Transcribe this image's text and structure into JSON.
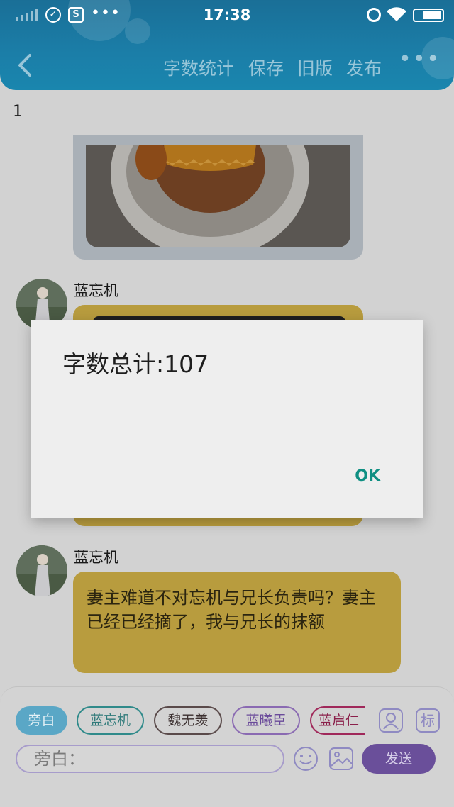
{
  "status_bar": {
    "time": "17:38",
    "sim_label": "S",
    "dots": "•••"
  },
  "nav": {
    "items": [
      "字数统计",
      "保存",
      "旧版",
      "发布"
    ],
    "more": "•••"
  },
  "page_number": "1",
  "messages": [
    {
      "sender": "蓝忘机"
    },
    {
      "sender": "蓝忘机",
      "text": "妻主难道不对忘机与兄长负责吗？妻主已经已经摘了，我与兄长的抹额"
    }
  ],
  "dialog": {
    "message": "字数总计:107",
    "ok": "OK"
  },
  "bottom": {
    "chips": [
      "旁白",
      "蓝忘机",
      "魏无羡",
      "蓝曦臣",
      "蓝启仁"
    ],
    "tag_icon_label": "标",
    "input_placeholder": "旁白：",
    "send_label": "发送"
  },
  "colors": {
    "header": "#1b7ea8",
    "bubble": "#b89c3e",
    "ok": "#0f8f82",
    "send": "#6a4f9a"
  }
}
